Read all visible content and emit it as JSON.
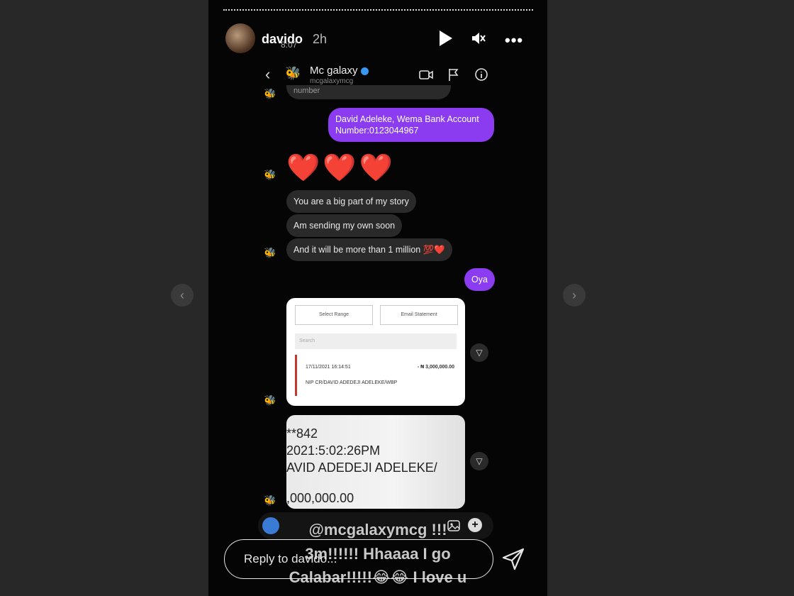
{
  "story": {
    "username": "davido",
    "time": "2h",
    "overlay_time": "8:07"
  },
  "dm": {
    "contact_name": "Mc galaxy",
    "contact_handle": "mcgalaxymcg",
    "clipped_text": "number",
    "messages": {
      "sent_account": "David Adeleke, Wema Bank Account Number:0123044967",
      "hearts": "❤️❤️❤️",
      "m1": "You are a big part of my story",
      "m2": "Am sending my own soon",
      "m3": "And it will be more than 1 million 💯❤️",
      "oya": "Oya"
    },
    "statement": {
      "btn_range": "Select Range",
      "btn_email": "Email Statement",
      "search": "Search",
      "txn_date": "17/11/2021 16:14:51",
      "txn_amount": "- ₦ 3,000,000.00",
      "txn_desc": "NIP CR/DAVID ADEDEJI ADELEKE/WBP"
    },
    "receipt_lines": [
      "**842",
      "2021:5:02:26PM",
      "AVID ADEDEJI ADELEKE/",
      "",
      ",000,000.00"
    ]
  },
  "caption": {
    "line1": "@mcgalaxymcg !!!",
    "line2": "3m!!!!!! Hhaaaa I go",
    "line3": "Calabar!!!!!😂😂 I love u"
  },
  "reply": {
    "placeholder": "Reply to davido..."
  },
  "colors": {
    "sent_bubble": "#8b3bf0",
    "received_bubble": "#2a2a2a",
    "verified": "#3897f0"
  }
}
